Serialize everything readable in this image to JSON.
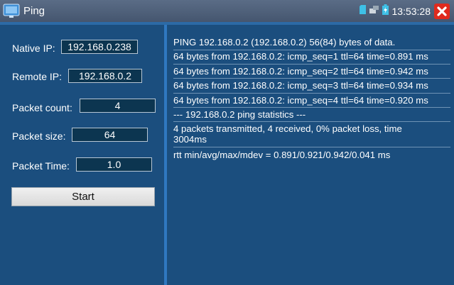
{
  "header": {
    "title": "Ping",
    "clock": "13:53:28"
  },
  "form": {
    "native_ip_label": "Native IP:",
    "native_ip_value": "192.168.0.238",
    "remote_ip_label": "Remote IP:",
    "remote_ip_value": "192.168.0.2",
    "packet_count_label": "Packet count:",
    "packet_count_value": "4",
    "packet_size_label": "Packet size:",
    "packet_size_value": "64",
    "packet_time_label": "Packet Time:",
    "packet_time_value": "1.0",
    "start_label": "Start"
  },
  "output": [
    "PING 192.168.0.2 (192.168.0.2) 56(84) bytes of data.",
    "64 bytes from 192.168.0.2: icmp_seq=1 ttl=64 time=0.891 ms",
    "64 bytes from 192.168.0.2: icmp_seq=2 ttl=64 time=0.942 ms",
    "64 bytes from 192.168.0.2: icmp_seq=3 ttl=64 time=0.934 ms",
    "64 bytes from 192.168.0.2: icmp_seq=4 ttl=64 time=0.920 ms",
    "--- 192.168.0.2 ping statistics ---",
    "4 packets transmitted, 4 received, 0% packet loss, time 3004ms",
    "rtt min/avg/max/mdev = 0.891/0.921/0.942/0.041 ms"
  ],
  "icons": {
    "app": "ping-app-icon",
    "status": [
      "sd-card-icon",
      "network-icon",
      "battery-icon"
    ],
    "close": "close-icon"
  },
  "colors": {
    "background": "#1b4e7e",
    "divider": "#2f78c0",
    "close": "#e02a1e"
  }
}
